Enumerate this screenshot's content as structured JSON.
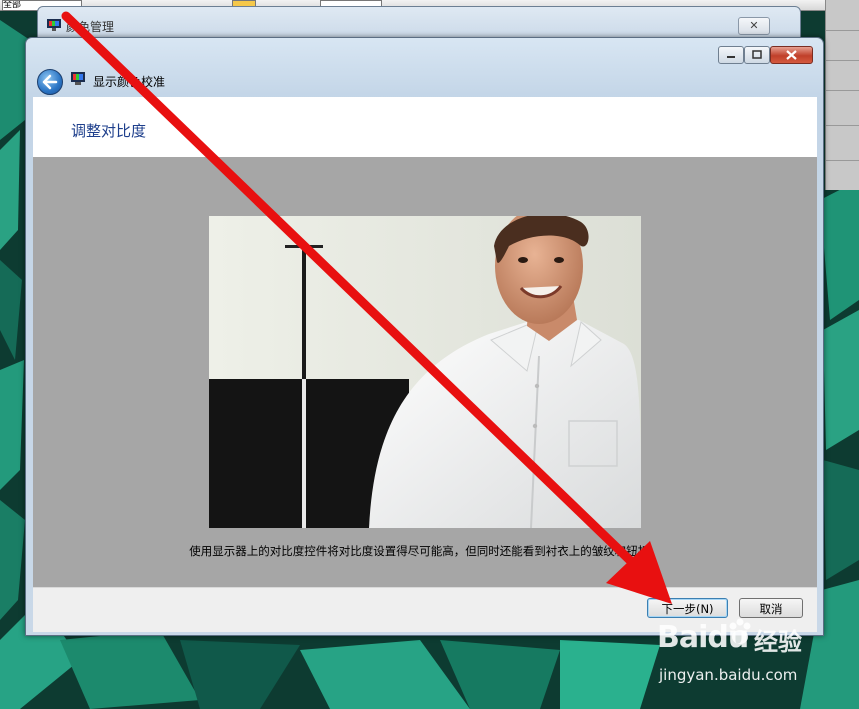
{
  "toolbar": {
    "combo_label": "全部"
  },
  "back_window": {
    "title": "颜色管理",
    "close_glyph": "✕"
  },
  "main_window": {
    "nav_title": "显示颜色校准",
    "page_title": "调整对比度",
    "instruction": "使用显示器上的对比度控件将对比度设置得尽可能高，但同时还能看到衬衣上的皱纹和钮扣。",
    "next_label": "下一步(N)",
    "cancel_label": "取消",
    "icons": [
      "back-arrow-icon",
      "display-calibration-icon",
      "minimize-icon",
      "maximize-icon",
      "close-icon"
    ]
  },
  "watermark": {
    "brand": "Baidu",
    "product": "经验",
    "url": "jingyan.baidu.com"
  },
  "colors": {
    "title_blue": "#1e3f8c",
    "arrow_red": "#e81010",
    "desktop_teal": "#1f8f74"
  }
}
